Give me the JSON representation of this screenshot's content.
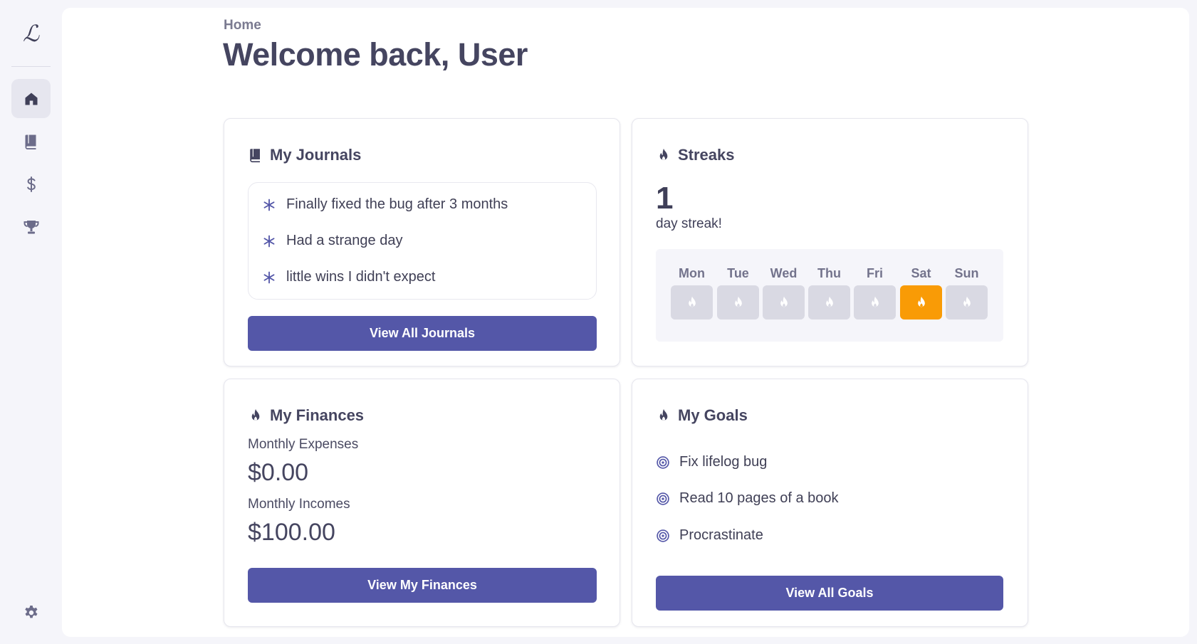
{
  "app": {
    "logo": "ℒ"
  },
  "sidebar": {
    "items": [
      {
        "icon": "home-icon",
        "active": true
      },
      {
        "icon": "book-icon",
        "active": false
      },
      {
        "icon": "dollar-icon",
        "active": false
      },
      {
        "icon": "trophy-icon",
        "active": false
      }
    ],
    "settings_icon": "gear-icon"
  },
  "header": {
    "breadcrumb": "Home",
    "title": "Welcome back, User"
  },
  "journals": {
    "title": "My Journals",
    "entries": [
      "Finally fixed the bug after 3 months",
      "Had a strange day",
      "little wins I didn't expect"
    ],
    "button": "View All Journals"
  },
  "streaks": {
    "title": "Streaks",
    "count": "1",
    "label": "day streak!",
    "days": [
      {
        "name": "Mon",
        "active": false
      },
      {
        "name": "Tue",
        "active": false
      },
      {
        "name": "Wed",
        "active": false
      },
      {
        "name": "Thu",
        "active": false
      },
      {
        "name": "Fri",
        "active": false
      },
      {
        "name": "Sat",
        "active": true
      },
      {
        "name": "Sun",
        "active": false
      }
    ]
  },
  "finances": {
    "title": "My Finances",
    "expenses_label": "Monthly Expenses",
    "expenses_value": "$0.00",
    "incomes_label": "Monthly Incomes",
    "incomes_value": "$100.00",
    "button": "View My Finances"
  },
  "goals": {
    "title": "My Goals",
    "items": [
      "Fix lifelog bug",
      "Read 10 pages of a book",
      "Procrastinate"
    ],
    "button": "View All Goals"
  },
  "colors": {
    "accent": "#5457a8",
    "streak_active": "#f99b06",
    "streak_inactive": "#d9d9e3",
    "icon": "#6c6c8a"
  }
}
